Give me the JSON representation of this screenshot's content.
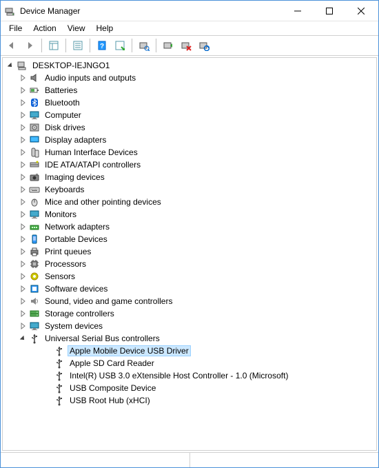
{
  "title": "Device Manager",
  "menus": [
    "File",
    "Action",
    "View",
    "Help"
  ],
  "computer_name": "DESKTOP-IEJNGO1",
  "categories": [
    {
      "label": "Audio inputs and outputs",
      "icon": "speaker",
      "expanded": false
    },
    {
      "label": "Batteries",
      "icon": "battery",
      "expanded": false
    },
    {
      "label": "Bluetooth",
      "icon": "bluetooth",
      "expanded": false
    },
    {
      "label": "Computer",
      "icon": "monitor",
      "expanded": false
    },
    {
      "label": "Disk drives",
      "icon": "disk",
      "expanded": false
    },
    {
      "label": "Display adapters",
      "icon": "display",
      "expanded": false
    },
    {
      "label": "Human Interface Devices",
      "icon": "hid",
      "expanded": false
    },
    {
      "label": "IDE ATA/ATAPI controllers",
      "icon": "ide",
      "expanded": false
    },
    {
      "label": "Imaging devices",
      "icon": "camera",
      "expanded": false
    },
    {
      "label": "Keyboards",
      "icon": "keyboard",
      "expanded": false
    },
    {
      "label": "Mice and other pointing devices",
      "icon": "mouse",
      "expanded": false
    },
    {
      "label": "Monitors",
      "icon": "monitor",
      "expanded": false
    },
    {
      "label": "Network adapters",
      "icon": "network",
      "expanded": false
    },
    {
      "label": "Portable Devices",
      "icon": "portable",
      "expanded": false
    },
    {
      "label": "Print queues",
      "icon": "printer",
      "expanded": false
    },
    {
      "label": "Processors",
      "icon": "cpu",
      "expanded": false
    },
    {
      "label": "Sensors",
      "icon": "sensor",
      "expanded": false
    },
    {
      "label": "Software devices",
      "icon": "software",
      "expanded": false
    },
    {
      "label": "Sound, video and game controllers",
      "icon": "sound",
      "expanded": false
    },
    {
      "label": "Storage controllers",
      "icon": "storage",
      "expanded": false
    },
    {
      "label": "System devices",
      "icon": "monitor",
      "expanded": false
    },
    {
      "label": "Universal Serial Bus controllers",
      "icon": "usb",
      "expanded": true,
      "children": [
        {
          "label": "Apple Mobile Device USB Driver",
          "icon": "usb",
          "selected": true
        },
        {
          "label": "Apple SD Card Reader",
          "icon": "usb"
        },
        {
          "label": "Intel(R) USB 3.0 eXtensible Host Controller - 1.0 (Microsoft)",
          "icon": "usb"
        },
        {
          "label": "USB Composite Device",
          "icon": "usb"
        },
        {
          "label": "USB Root Hub (xHCI)",
          "icon": "usb"
        }
      ]
    }
  ]
}
